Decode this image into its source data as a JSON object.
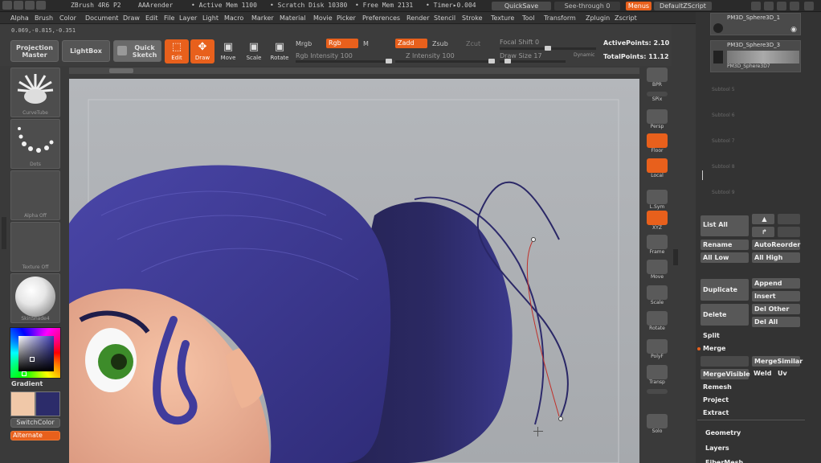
{
  "titlebar": {
    "app": "ZBrush 4R6 P2",
    "render": "AAArender",
    "active_mem": "• Active Mem 1100",
    "scratch": "• Scratch Disk 10380",
    "free_mem": "• Free Mem 2131",
    "timer": "• Timer▸0.004",
    "quicksave": "QuickSave",
    "seethrough": "See-through  0",
    "menus": "Menus",
    "script": "DefaultZScript"
  },
  "menus": [
    "Alpha",
    "Brush",
    "Color",
    "Document",
    "Draw",
    "Edit",
    "File",
    "Layer",
    "Light",
    "Macro",
    "Marker",
    "Material",
    "Movie",
    "Picker",
    "Preferences",
    "Render",
    "Stencil",
    "Stroke",
    "Texture",
    "Tool",
    "Transform",
    "Zplugin",
    "Zscript"
  ],
  "toolbar": {
    "coords": "0.069,-0.815,-0.351",
    "projection_master": "Projection Master",
    "lightbox": "LightBox",
    "quick_sketch": "Quick Sketch",
    "edit": "Edit",
    "draw": "Draw",
    "move": "Move",
    "scale": "Scale",
    "rotate": "Rotate",
    "mrgb": "Mrgb",
    "rgb": "Rgb",
    "m": "M",
    "rgb_intensity": "Rgb Intensity 100",
    "zadd": "Zadd",
    "zsub": "Zsub",
    "zcut": "Zcut",
    "z_intensity": "Z Intensity 100",
    "focal_shift": "Focal Shift 0",
    "draw_size": "Draw Size 17",
    "dynamic": "Dynamic",
    "active_points": "ActivePoints: 2.10",
    "total_points": "TotalPoints: 11.12"
  },
  "left_tray": {
    "brush_caption": "CurveTube",
    "stroke_caption": "Dots",
    "alpha_caption": "Alpha Off",
    "texture_caption": "Texture Off",
    "material_caption": "SkinShade4",
    "gradient": "Gradient",
    "switch_color": "SwitchColor",
    "alternate": "Alternate",
    "primary_color": "#f0c8a8",
    "secondary_color": "#2c2c6a"
  },
  "right_shelf": [
    {
      "name": "bpr-button",
      "label": "BPR",
      "icon": "bpr-icon",
      "orange": false
    },
    {
      "name": "spix-button",
      "label": "SPix",
      "icon": "spix-icon",
      "orange": false
    },
    {
      "name": "persp-button",
      "label": "Persp",
      "icon": "persp-icon",
      "orange": false
    },
    {
      "name": "floor-button",
      "label": "Floor",
      "icon": "floor-icon",
      "orange": true
    },
    {
      "name": "local-button",
      "label": "Local",
      "icon": "local-icon",
      "orange": true
    },
    {
      "name": "lsym-button",
      "label": "L.Sym",
      "icon": "lsym-icon",
      "orange": false
    },
    {
      "name": "xyz-button",
      "label": "XYZ",
      "icon": "xyz-icon",
      "orange": true
    },
    {
      "name": "frame-button",
      "label": "Frame",
      "icon": "frame-icon",
      "orange": false
    },
    {
      "name": "move-button",
      "label": "Move",
      "icon": "hand-icon",
      "orange": false
    },
    {
      "name": "scale-button",
      "label": "Scale",
      "icon": "scale-icon",
      "orange": false
    },
    {
      "name": "rotate-button",
      "label": "Rotate",
      "icon": "rotate-icon",
      "orange": false
    },
    {
      "name": "polyf-button",
      "label": "PolyF",
      "icon": "polyf-icon",
      "orange": false
    },
    {
      "name": "transp-button",
      "label": "Transp",
      "icon": "transp-icon",
      "orange": false
    },
    {
      "name": "ghost-button",
      "label": "",
      "icon": "ghost-icon",
      "orange": false
    },
    {
      "name": "solo-button",
      "label": "Solo",
      "icon": "solo-icon",
      "orange": false
    }
  ],
  "subtools": {
    "item1": "PM3D_Sphere3D_1",
    "item2": "PM3D_Sphere3D_3",
    "item2_sub": "PM3D_Sphere3D7",
    "empty": [
      "Subtool 5",
      "Subtool 6",
      "Subtool 7",
      "Subtool 8",
      "Subtool 9"
    ]
  },
  "panel": {
    "list_all": "List All",
    "rename": "Rename",
    "auto_reorder": "AutoReorder",
    "all_low": "All Low",
    "all_high": "All High",
    "duplicate": "Duplicate",
    "append": "Append",
    "insert": "Insert",
    "delete": "Delete",
    "del_other": "Del Other",
    "del_all": "Del All",
    "split": "Split",
    "merge": "Merge",
    "merge_similar": "MergeSimilar",
    "merge_visible": "MergeVisible",
    "weld": "Weld",
    "uv": "Uv",
    "remesh": "Remesh",
    "project": "Project",
    "extract": "Extract",
    "geometry": "Geometry",
    "layers": "Layers",
    "fiber": "FiberMesh"
  }
}
